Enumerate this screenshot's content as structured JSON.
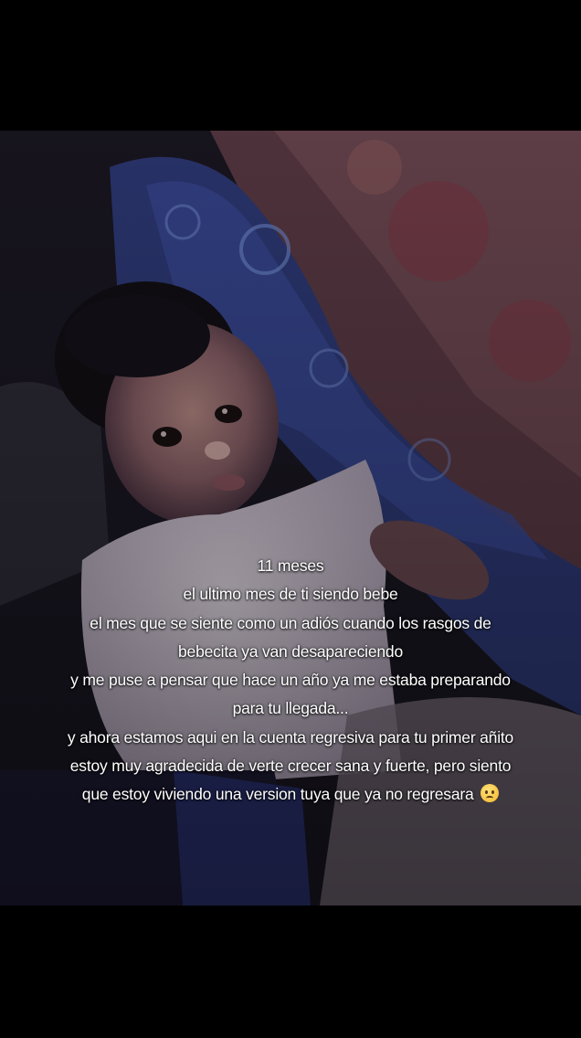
{
  "photo": {
    "subject": "baby-photo"
  },
  "caption": {
    "lines": [
      "11 meses",
      "el ultimo mes de ti siendo bebe",
      "el mes que se siente como un adiós cuando los rasgos de",
      "bebecita ya van desapareciendo",
      "y me puse a pensar que hace un año ya me estaba preparando",
      "para tu llegada...",
      "y ahora estamos aqui en la cuenta regresiva para tu primer añito",
      "estoy muy agradecida de verte crecer sana y fuerte, pero siento",
      "que estoy viviendo una version tuya que ya no regresara"
    ],
    "emoji": "pleading-face-emoji"
  }
}
